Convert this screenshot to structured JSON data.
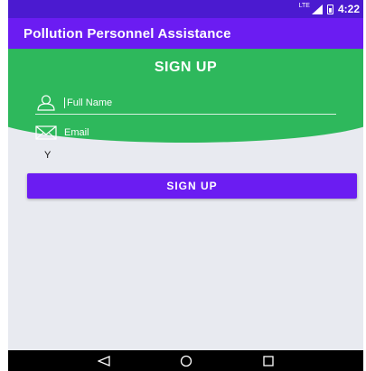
{
  "status_bar": {
    "network": "LTE",
    "time": "4:22"
  },
  "app_bar": {
    "title": "Pollution Personnel Assistance"
  },
  "form": {
    "title": "SIGN UP",
    "full_name_placeholder": "Full Name",
    "email_placeholder": "Email",
    "extra_label": "Y",
    "signup_button_label": "SIGN UP"
  },
  "icons": {
    "person": "person-icon",
    "email": "envelope-icon",
    "back": "nav-back-icon",
    "home": "nav-home-icon",
    "recents": "nav-recents-icon"
  },
  "colors": {
    "status_bar": "#4b1ad0",
    "app_bar": "#6b1cf2",
    "header": "#2eb85c",
    "button": "#6b1cf2",
    "background": "#e8eaf0"
  }
}
